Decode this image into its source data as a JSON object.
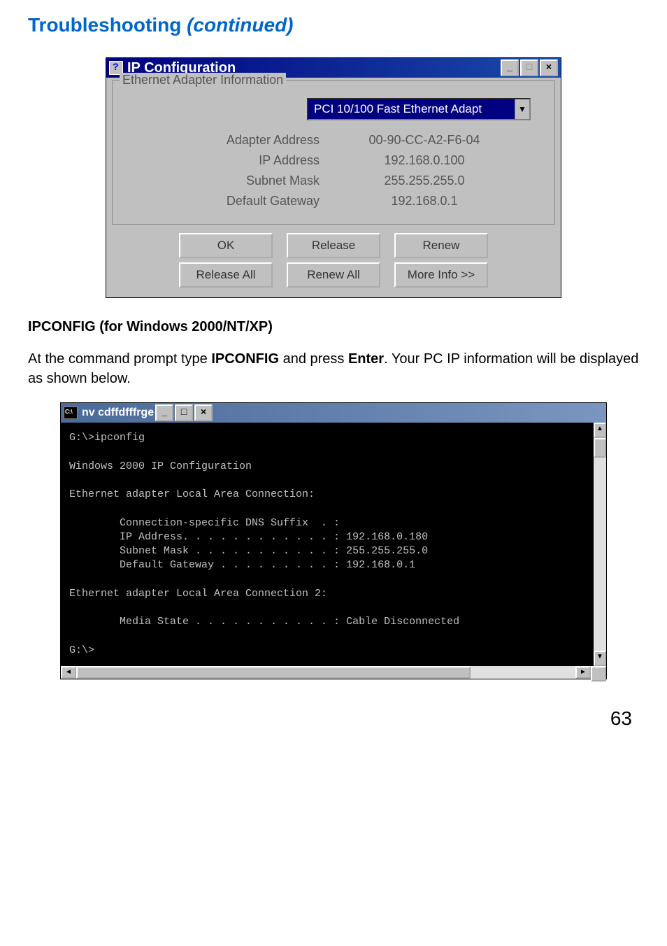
{
  "heading": {
    "main": "Troubleshooting ",
    "cont": "(continued)"
  },
  "ipconfig_dialog": {
    "title": "IP Configuration",
    "group_legend": "Ethernet Adapter Information",
    "adapter_selected": "PCI 10/100 Fast Ethernet Adapt",
    "rows": {
      "adapter_address": {
        "label": "Adapter Address",
        "value": "00-90-CC-A2-F6-04"
      },
      "ip_address": {
        "label": "IP Address",
        "value": "192.168.0.100"
      },
      "subnet_mask": {
        "label": "Subnet Mask",
        "value": "255.255.255.0"
      },
      "default_gateway": {
        "label": "Default Gateway",
        "value": "192.168.0.1"
      }
    },
    "buttons": {
      "ok": "OK",
      "release": "Release",
      "renew": "Renew",
      "release_all": "Release All",
      "renew_all": "Renew All",
      "more_info": "More Info >>"
    }
  },
  "subheading": "IPCONFIG (for Windows 2000/NT/XP)",
  "paragraph": {
    "p1": "At the command prompt type ",
    "b1": "IPCONFIG",
    "p2": " and press ",
    "b2": "Enter",
    "p3": ". Your PC IP information will be displayed as shown below."
  },
  "console": {
    "title": "nv cdffdfffrge",
    "lines": "G:\\>ipconfig\n\nWindows 2000 IP Configuration\n\nEthernet adapter Local Area Connection:\n\n        Connection-specific DNS Suffix  . :\n        IP Address. . . . . . . . . . . . : 192.168.0.180\n        Subnet Mask . . . . . . . . . . . : 255.255.255.0\n        Default Gateway . . . . . . . . . : 192.168.0.1\n\nEthernet adapter Local Area Connection 2:\n\n        Media State . . . . . . . . . . . : Cable Disconnected\n\nG:\\>"
  },
  "page_number": "63"
}
